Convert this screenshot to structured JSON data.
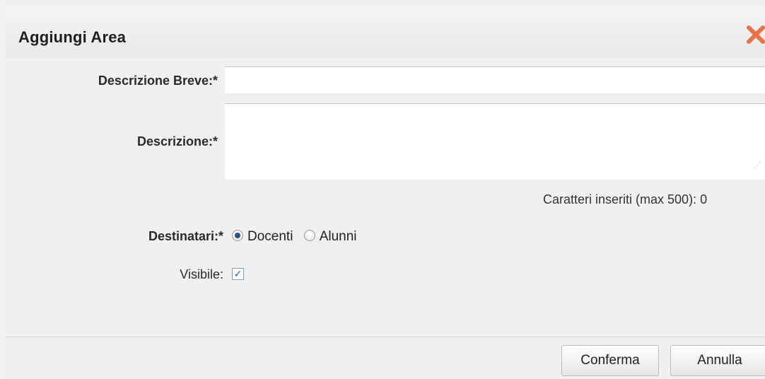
{
  "dialog": {
    "title": "Aggiungi Area",
    "close_icon": "close-x-icon",
    "close_color": "#e8724a"
  },
  "form": {
    "descrizione_breve": {
      "label": "Descrizione Breve:*",
      "value": "",
      "placeholder": ""
    },
    "descrizione": {
      "label": "Descrizione:*",
      "value": "",
      "placeholder": ""
    },
    "counter_text": "Caratteri inseriti (max 500): 0",
    "destinatari": {
      "label": "Destinatari:*",
      "options": [
        {
          "label": "Docenti",
          "checked": true
        },
        {
          "label": "Alunni",
          "checked": false
        }
      ]
    },
    "visibile": {
      "label": "Visibile:",
      "checked": true
    }
  },
  "buttons": {
    "confirm_label": "Conferma",
    "cancel_label": "Annulla"
  }
}
